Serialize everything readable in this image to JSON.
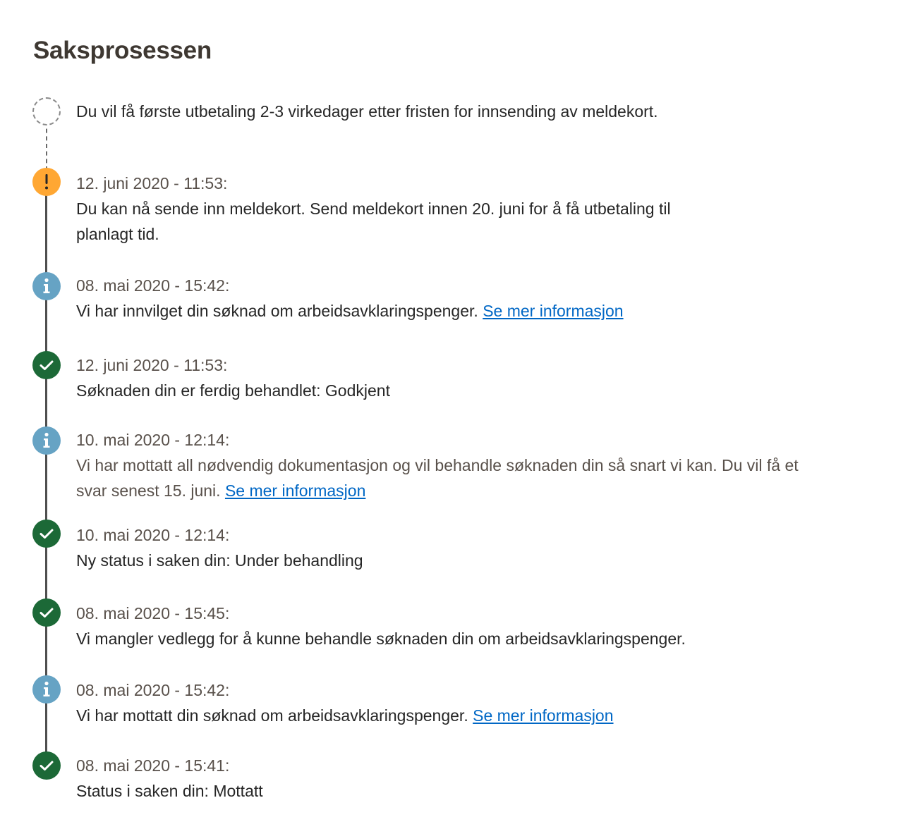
{
  "page": {
    "title": "Saksprosessen"
  },
  "colors": {
    "warning": "#ffa733",
    "info": "#66a3c4",
    "success": "#1c6937",
    "link": "#0067c5"
  },
  "pending": {
    "icon": "pending-circle-icon",
    "message": "Du vil få første utbetaling 2-3 virkedager etter fristen for innsending av meldekort."
  },
  "events": [
    {
      "icon": "warning-icon",
      "date": "12. juni 2020 - 11:53:",
      "message": "Du kan nå sende inn meldekort. Send meldekort innen 20. juni for å få utbetaling til planlagt tid."
    },
    {
      "icon": "info-icon",
      "date": "08. mai 2020 - 15:42:",
      "message": "Vi har innvilget din søknad om arbeidsavklaringspenger.",
      "link": "Se mer informasjon"
    },
    {
      "icon": "checkmark-icon",
      "date": "12. juni 2020 - 11:53:",
      "message": "Søknaden din er ferdig behandlet: Godkjent"
    },
    {
      "icon": "info-icon",
      "date": "10. mai 2020 - 12:14:",
      "message": "Vi har mottatt all nødvendig dokumentasjon og vil behandle søknaden din så snart vi kan. Du vil få et svar senest 15. juni.",
      "link": "Se mer informasjon"
    },
    {
      "icon": "checkmark-icon",
      "date": "10. mai 2020 - 12:14:",
      "message": "Ny status i saken din: Under behandling"
    },
    {
      "icon": "checkmark-icon",
      "date": "08. mai 2020 - 15:45:",
      "message": "Vi mangler vedlegg for å kunne behandle søknaden din om arbeidsavklaringspenger."
    },
    {
      "icon": "info-icon",
      "date": "08. mai 2020 - 15:42:",
      "message": "Vi har mottatt din søknad om arbeidsavklaringspenger.",
      "link": "Se mer informasjon"
    },
    {
      "icon": "checkmark-icon",
      "date": "08. mai 2020 - 15:41:",
      "message": "Status i saken din: Mottatt"
    }
  ]
}
